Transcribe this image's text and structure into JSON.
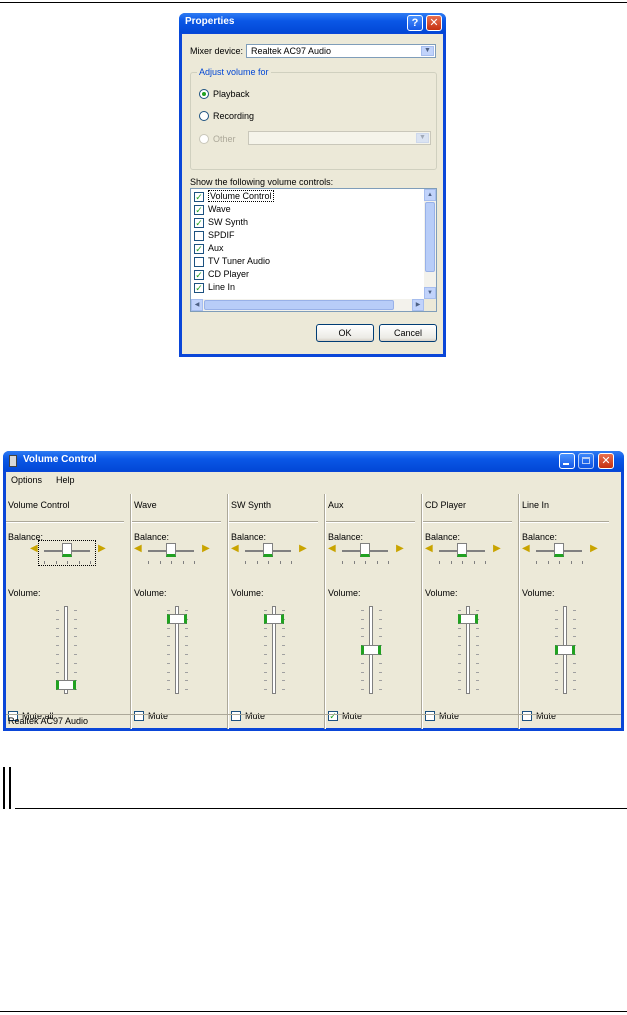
{
  "properties_dialog": {
    "title": "Properties",
    "help_glyph": "?",
    "close_glyph": "✕",
    "mixer_device_label": "Mixer device:",
    "mixer_device_value": "Realtek AC97 Audio",
    "adjust_group_title": "Adjust volume for",
    "radio_playback": "Playback",
    "radio_recording": "Recording",
    "radio_other": "Other",
    "show_controls_label": "Show the following volume controls:",
    "controls": [
      {
        "label": "Volume Control",
        "checked": true
      },
      {
        "label": "Wave",
        "checked": true
      },
      {
        "label": "SW Synth",
        "checked": true
      },
      {
        "label": "SPDIF",
        "checked": false
      },
      {
        "label": "Aux",
        "checked": true
      },
      {
        "label": "TV Tuner Audio",
        "checked": false
      },
      {
        "label": "CD Player",
        "checked": true
      },
      {
        "label": "Line In",
        "checked": true
      }
    ],
    "ok_label": "OK",
    "cancel_label": "Cancel"
  },
  "volume_window": {
    "title": "Volume Control",
    "menu": [
      "Options",
      "Help"
    ],
    "balance_label": "Balance:",
    "volume_label": "Volume:",
    "channels": [
      {
        "name": "Volume Control",
        "mute_label": "Mute all",
        "muted": false,
        "level": 0.05
      },
      {
        "name": "Wave",
        "mute_label": "Mute",
        "muted": false,
        "level": 0.9
      },
      {
        "name": "SW Synth",
        "mute_label": "Mute",
        "muted": false,
        "level": 0.9
      },
      {
        "name": "Aux",
        "mute_label": "Mute",
        "muted": true,
        "level": 0.5
      },
      {
        "name": "CD Player",
        "mute_label": "Mute",
        "muted": false,
        "level": 0.9
      },
      {
        "name": "Line In",
        "mute_label": "Mute",
        "muted": false,
        "level": 0.5
      }
    ],
    "status": "Realtek AC97 Audio"
  }
}
